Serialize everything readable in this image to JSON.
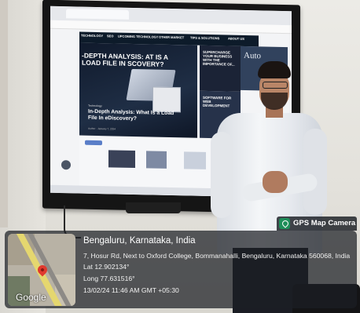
{
  "gps_camera": {
    "app_name": "GPS Map Camera",
    "map_attribution": "Google",
    "location_title": "Bengaluru, Karnataka, India",
    "address": "7, Hosur Rd, Next to Oxford College, Bommanahalli, Bengaluru, Karnataka 560068, India",
    "latitude": "Lat 12.902134°",
    "longitude": "Long 77.631516°",
    "timestamp": "13/02/24 11:46 AM GMT +05:30"
  },
  "tv_screen": {
    "nav_items": [
      "TECHNOLOGY",
      "SEO",
      "UPCOMING TECHNOLOGY",
      "OTHER MARKET",
      "TIPS & SOLUTIONS",
      "ABOUT US"
    ],
    "hero_headline": "-DEPTH ANALYSIS: AT IS A LOAD FILE IN SCOVERY?",
    "category_tag": "Technology",
    "article_title": "In-Depth Analysis: What Is a Load File In eDiscovery?",
    "article_meta": "Author · January 7, 2024",
    "side_story_1": "SUPERCHARGE YOUR BUSINESS WITH THE IMPORTANCE OF...",
    "side_story_2": "SOFTWARE FOR WEB DEVELOPMENT",
    "side_story_3": "Auto"
  }
}
